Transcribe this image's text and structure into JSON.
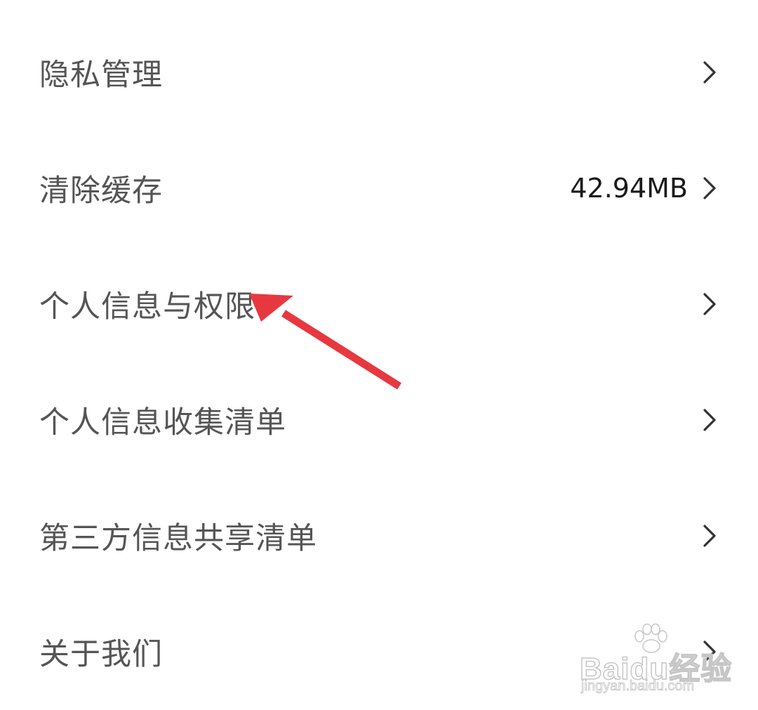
{
  "settings": {
    "items": [
      {
        "label": "隐私管理",
        "value": "",
        "icon": "chevron-right-icon"
      },
      {
        "label": "清除缓存",
        "value": "42.94MB",
        "icon": "chevron-right-icon"
      },
      {
        "label": "个人信息与权限",
        "value": "",
        "icon": "chevron-right-icon"
      },
      {
        "label": "个人信息收集清单",
        "value": "",
        "icon": "chevron-right-icon"
      },
      {
        "label": "第三方信息共享清单",
        "value": "",
        "icon": "chevron-right-icon"
      },
      {
        "label": "关于我们",
        "value": "",
        "icon": "chevron-right-icon"
      }
    ]
  },
  "annotation": {
    "icon": "red-arrow-icon",
    "color": "#e8383f",
    "target": "个人信息与权限"
  },
  "watermark": {
    "logo_text": "Baidu经验",
    "url": "jingyan.baidu.com"
  },
  "colors": {
    "background": "#ffffff",
    "label_text": "#555555",
    "value_text": "#1a1a1a",
    "chevron": "#333333"
  }
}
